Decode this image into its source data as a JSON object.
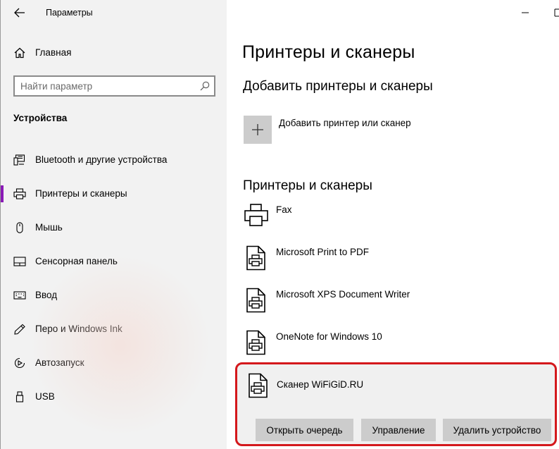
{
  "window": {
    "title": "Параметры",
    "controls": {
      "minimize": "minimize-icon",
      "maximize": "maximize-icon"
    }
  },
  "sidebar": {
    "home_label": "Главная",
    "search_placeholder": "Найти параметр",
    "section_title": "Устройства",
    "items": [
      {
        "label": "Bluetooth и другие устройства",
        "icon": "bluetooth-devices-icon",
        "active": false
      },
      {
        "label": "Принтеры и сканеры",
        "icon": "printer-icon",
        "active": true
      },
      {
        "label": "Мышь",
        "icon": "mouse-icon",
        "active": false
      },
      {
        "label": "Сенсорная панель",
        "icon": "touchpad-icon",
        "active": false
      },
      {
        "label": "Ввод",
        "icon": "keyboard-icon",
        "active": false
      },
      {
        "label": "Перо и Windows Ink",
        "icon": "pen-icon",
        "active": false
      },
      {
        "label": "Автозапуск",
        "icon": "autoplay-icon",
        "active": false
      },
      {
        "label": "USB",
        "icon": "usb-icon",
        "active": false
      }
    ]
  },
  "main": {
    "page_title": "Принтеры и сканеры",
    "add_section_title": "Добавить принтеры и сканеры",
    "add_button_label": "Добавить принтер или сканер",
    "list_title": "Принтеры и сканеры",
    "devices": [
      {
        "name": "Fax",
        "icon": "fax-icon"
      },
      {
        "name": "Microsoft Print to PDF",
        "icon": "printer-document-icon"
      },
      {
        "name": "Microsoft XPS Document Writer",
        "icon": "printer-document-icon"
      },
      {
        "name": "OneNote for Windows 10",
        "icon": "printer-document-icon"
      }
    ],
    "selected_device": {
      "name": "Сканер WiFiGiD.RU",
      "icon": "printer-document-icon",
      "actions": [
        "Открыть очередь",
        "Управление",
        "Удалить устройство"
      ]
    }
  },
  "colors": {
    "accent": "#8a1ab6",
    "highlight_border": "#d4181c",
    "sidebar_bg": "#f2f2f2",
    "tile_bg": "#cccccc"
  }
}
